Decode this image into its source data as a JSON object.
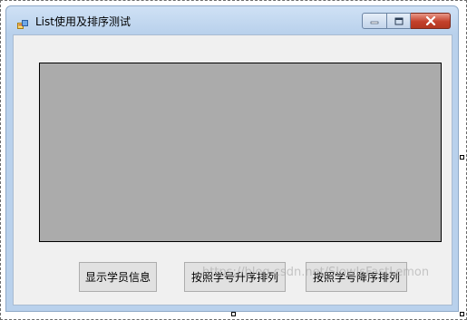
{
  "window": {
    "title": "List使用及排序测试",
    "controls": {
      "minimize_icon": "minimize-icon",
      "maximize_icon": "maximize-icon",
      "close_icon": "close-icon"
    }
  },
  "listbox": {
    "items": []
  },
  "buttons": {
    "show_info": "显示学员信息",
    "sort_asc": "按照学号升序排列",
    "sort_desc": "按照学号降序排列"
  },
  "watermark": "https://blog.csdn.net/SlowIsFastLemon",
  "colors": {
    "client_bg": "#f0f0f0",
    "listbox_bg": "#ababab",
    "button_bg": "#e1e1e1",
    "close_button": "#c4402b"
  }
}
